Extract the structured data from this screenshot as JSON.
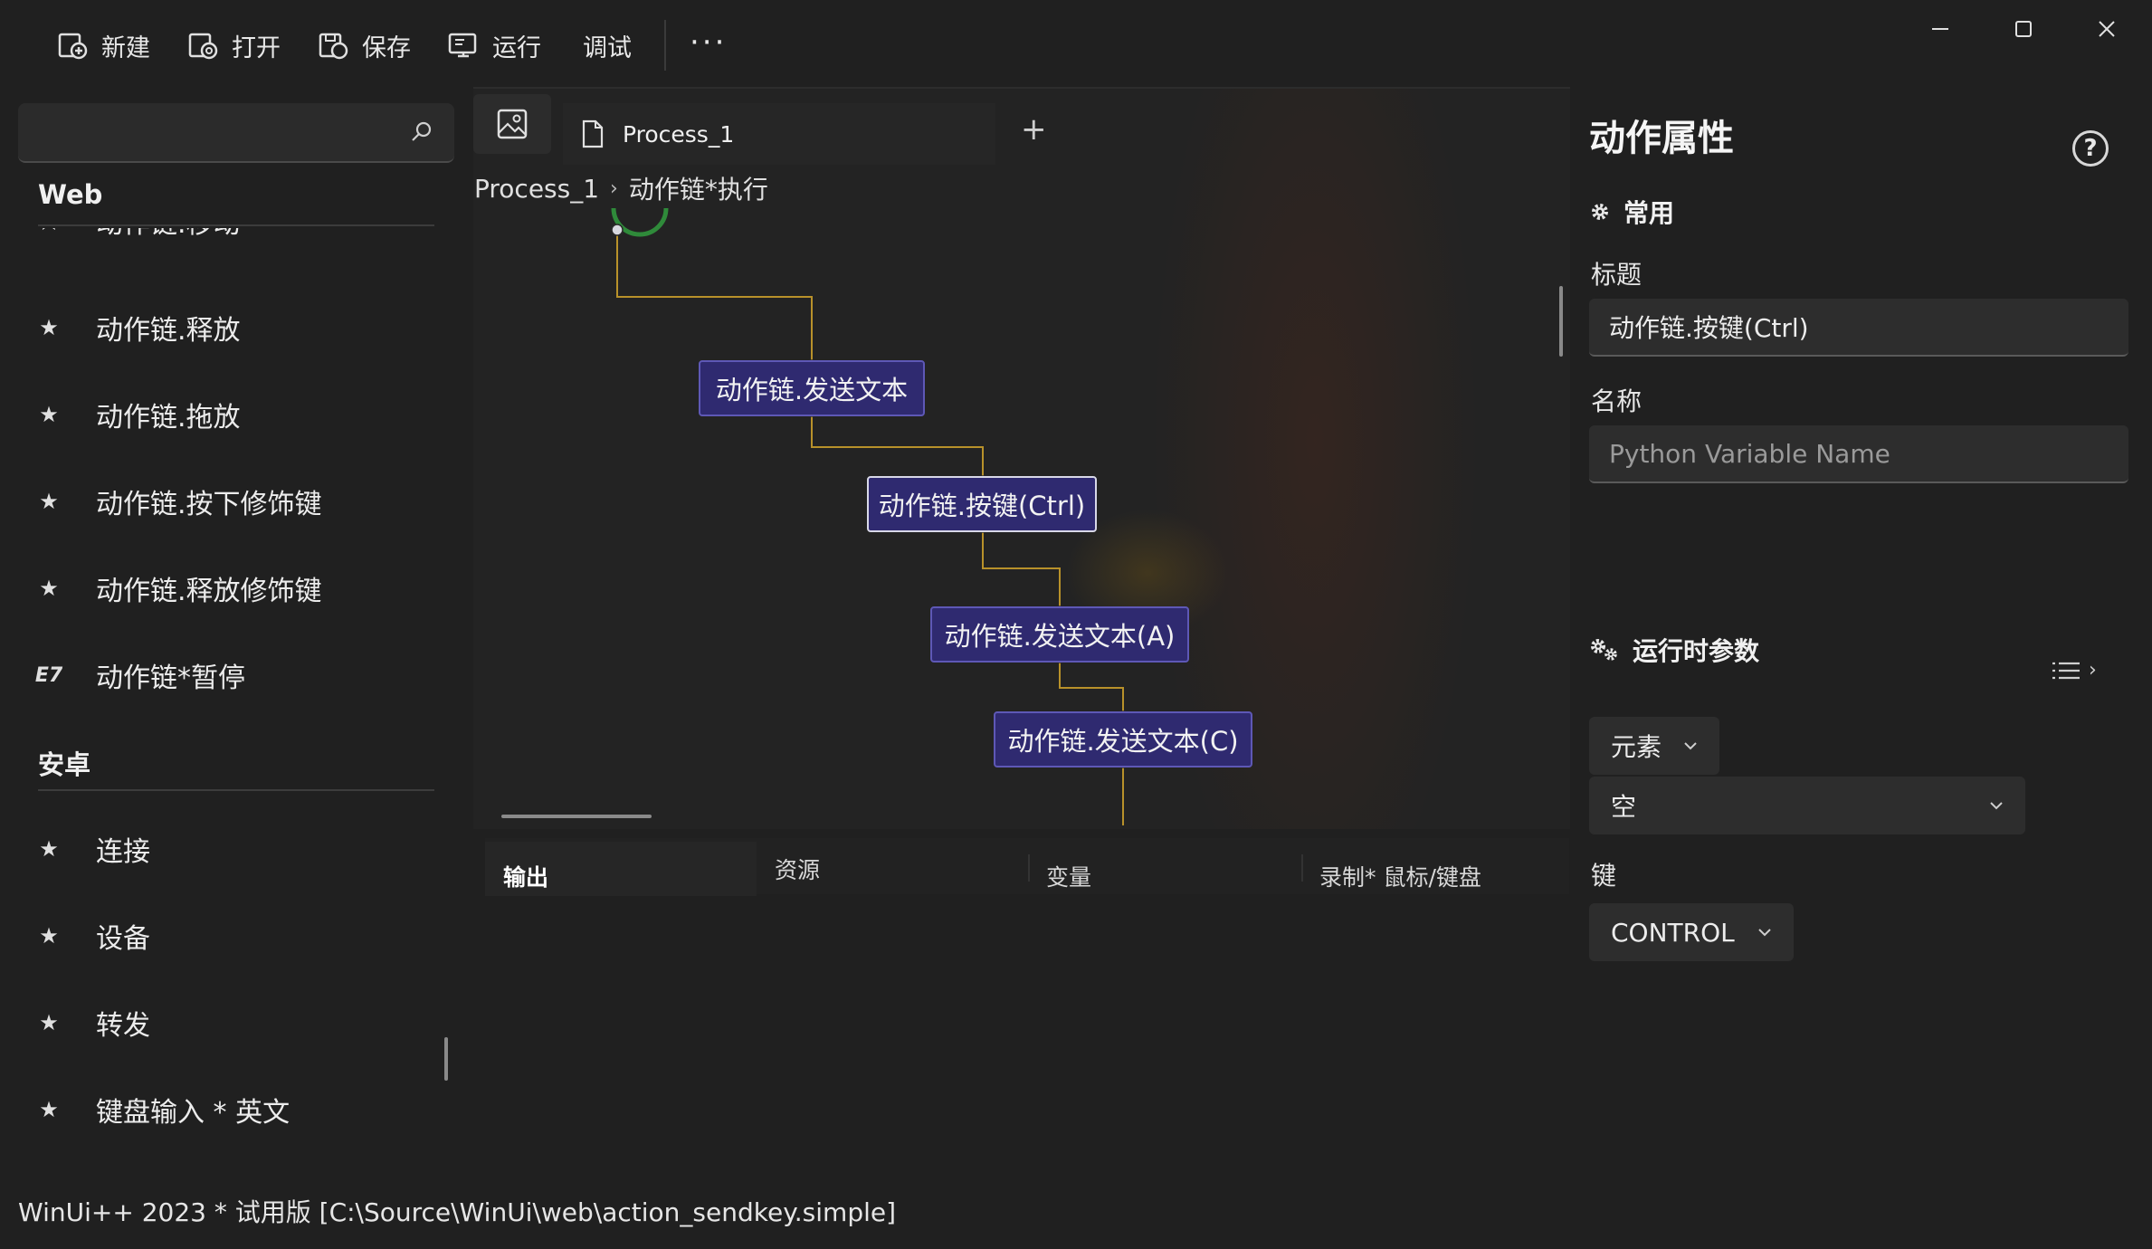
{
  "toolbar": {
    "new_label": "新建",
    "open_label": "打开",
    "save_label": "保存",
    "run_label": "运行",
    "debug_label": "调试",
    "more_label": "···"
  },
  "sidebar": {
    "search_placeholder": "",
    "section_web": "Web",
    "partial_item": "动作链.移动",
    "web_items": [
      {
        "label": "动作链.释放",
        "icon": "star-icon"
      },
      {
        "label": "动作链.拖放",
        "icon": "star-icon"
      },
      {
        "label": "动作链.按下修饰键",
        "icon": "star-icon"
      },
      {
        "label": "动作链.释放修饰键",
        "icon": "star-icon"
      },
      {
        "label": "动作链*暂停",
        "icon": "e7-icon",
        "icon_text": "E7"
      }
    ],
    "section_android": "安卓",
    "android_items": [
      {
        "label": "连接",
        "icon": "star-icon"
      },
      {
        "label": "设备",
        "icon": "star-icon"
      },
      {
        "label": "转发",
        "icon": "star-icon"
      },
      {
        "label": "键盘输入 * 英文",
        "icon": "star-icon"
      }
    ]
  },
  "editor": {
    "tab_label": "Process_1",
    "add_tab": "+",
    "breadcrumb": [
      "Process_1",
      "动作链*执行"
    ],
    "nodes": [
      {
        "label": "动作链.发送文本"
      },
      {
        "label": "动作链.按键(Ctrl)"
      },
      {
        "label": "动作链.发送文本(A)"
      },
      {
        "label": "动作链.发送文本(C)"
      }
    ],
    "bottom_tabs": [
      "输出",
      "资源",
      "变量",
      "录制* 鼠标/键盘"
    ]
  },
  "properties": {
    "title": "动作属性",
    "help": "?",
    "common_header": "常用",
    "title_label": "标题",
    "title_value": "动作链.按键(Ctrl)",
    "name_label": "名称",
    "name_placeholder": "Python Variable Name",
    "runtime_header": "运行时参数",
    "element_dropdown": "元素",
    "element_value": "空",
    "key_label": "键",
    "key_value": "CONTROL"
  },
  "status_bar": {
    "text": "WinUi++ 2023 * 试用版 [C:\\Source\\WinUi\\web\\action_sendkey.simple]"
  },
  "colors": {
    "background": "#202020",
    "node_fill": "#2f2a70",
    "node_border": "#5e58b6",
    "connector": "#b8912a"
  }
}
